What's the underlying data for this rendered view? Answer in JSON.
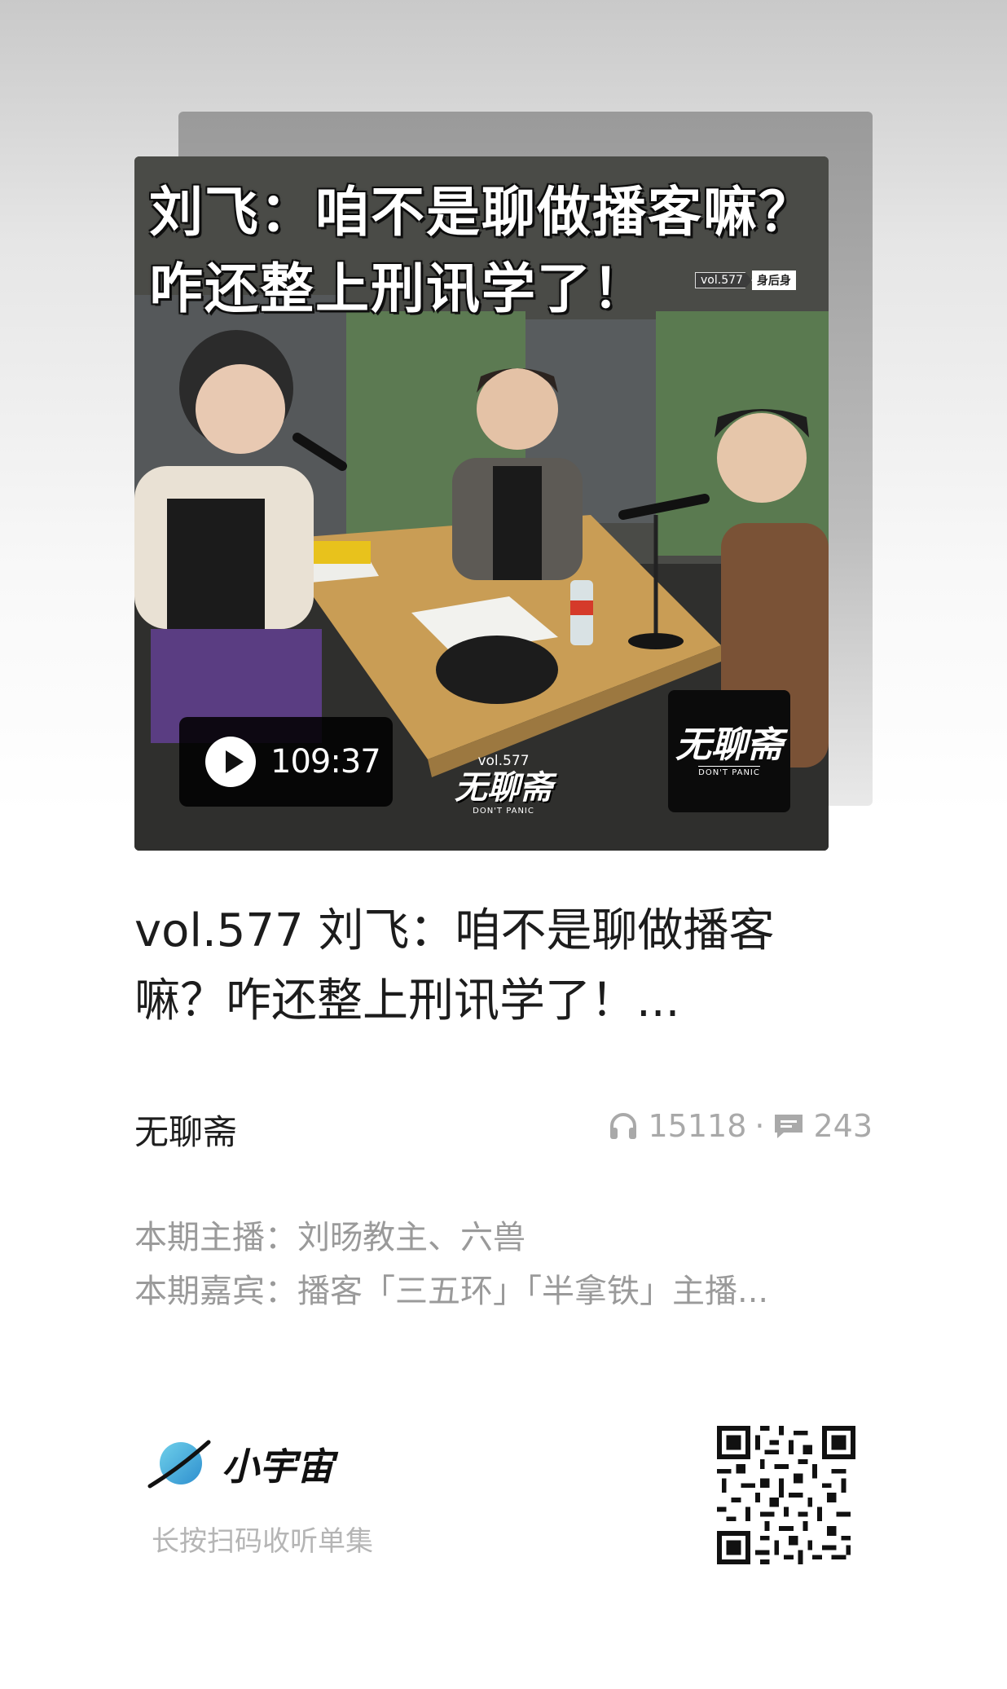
{
  "cover": {
    "title_line1": "刘飞：咱不是聊做播客嘛？",
    "title_line2": "咋还整上刑讯学了！",
    "tag_vol": "vol.577",
    "tag_sub": "身后身",
    "duration": "109:37",
    "vol_badge_vol": "vol.577",
    "vol_badge_name": "无聊斋",
    "vol_badge_slogan": "DON'T PANIC",
    "logo_name": "无聊斋",
    "logo_slogan": "DON'T PANIC"
  },
  "episode": {
    "title": "vol.577 刘飞：咱不是聊做播客嘛？咋还整上刑讯学了！...",
    "show_name": "无聊斋",
    "plays": "15118",
    "separator": "·",
    "comments": "243"
  },
  "description": {
    "line1": "本期主播：刘旸教主、六兽",
    "line2": "本期嘉宾：播客「三五环」「半拿铁」主播..."
  },
  "brand": {
    "name": "小宇宙",
    "hint": "长按扫码收听单集",
    "accent_color": "#4fb6e0"
  },
  "icons": {
    "play": "play-icon",
    "plays": "headphones-icon",
    "comments": "comment-icon",
    "logo": "planet-icon",
    "qr": "qr-code"
  }
}
